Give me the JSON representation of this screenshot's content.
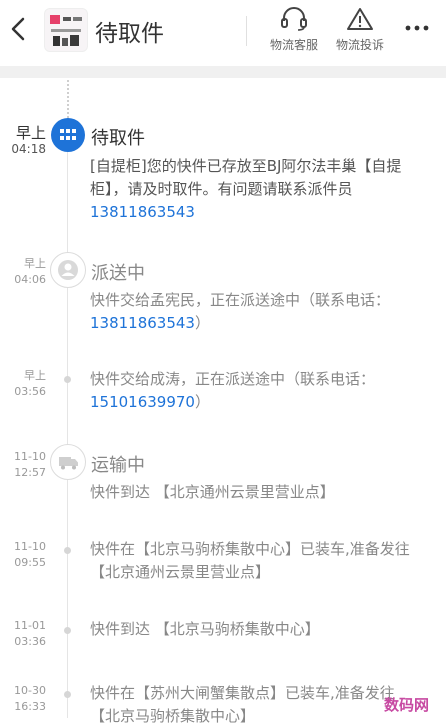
{
  "header": {
    "title": "待取件",
    "actions": [
      {
        "label": "物流客服",
        "icon": "headset-icon"
      },
      {
        "label": "物流投诉",
        "icon": "warning-icon"
      }
    ]
  },
  "timeline": [
    {
      "day": "早上",
      "time": "04:18",
      "status": "待取件",
      "text": "[自提柜]您的快件已存放至BJ阿尔法丰巢【自提柜】，请及时取件。有问题请联系派件员",
      "phone": "13811863543",
      "close": "",
      "icon": "grid-icon"
    },
    {
      "day": "早上",
      "time": "04:06",
      "status": "派送中",
      "text": "快件交给孟宪民，正在派送途中（联系电话：",
      "phone": "13811863543",
      "close": "）",
      "icon": "person-icon"
    },
    {
      "day": "早上",
      "time": "03:56",
      "status": "",
      "text": "快件交给成涛，正在派送途中（联系电话：",
      "phone": "15101639970",
      "close": "）",
      "icon": ""
    },
    {
      "day": "11-10",
      "time": "12:57",
      "status": "运输中",
      "text": "快件到达 【北京通州云景里营业点】",
      "phone": "",
      "close": "",
      "icon": "truck-icon"
    },
    {
      "day": "11-10",
      "time": "09:55",
      "status": "",
      "text": "快件在【北京马驹桥集散中心】已装车,准备发往 【北京通州云景里营业点】",
      "phone": "",
      "close": "",
      "icon": ""
    },
    {
      "day": "11-01",
      "time": "03:36",
      "status": "",
      "text": "快件到达 【北京马驹桥集散中心】",
      "phone": "",
      "close": "",
      "icon": ""
    },
    {
      "day": "10-30",
      "time": "16:33",
      "status": "",
      "text": "快件在【苏州大闸蟹集散点】已装车,准备发往 【北京马驹桥集散中心】",
      "phone": "",
      "close": "",
      "icon": ""
    }
  ],
  "watermark": "数码网"
}
